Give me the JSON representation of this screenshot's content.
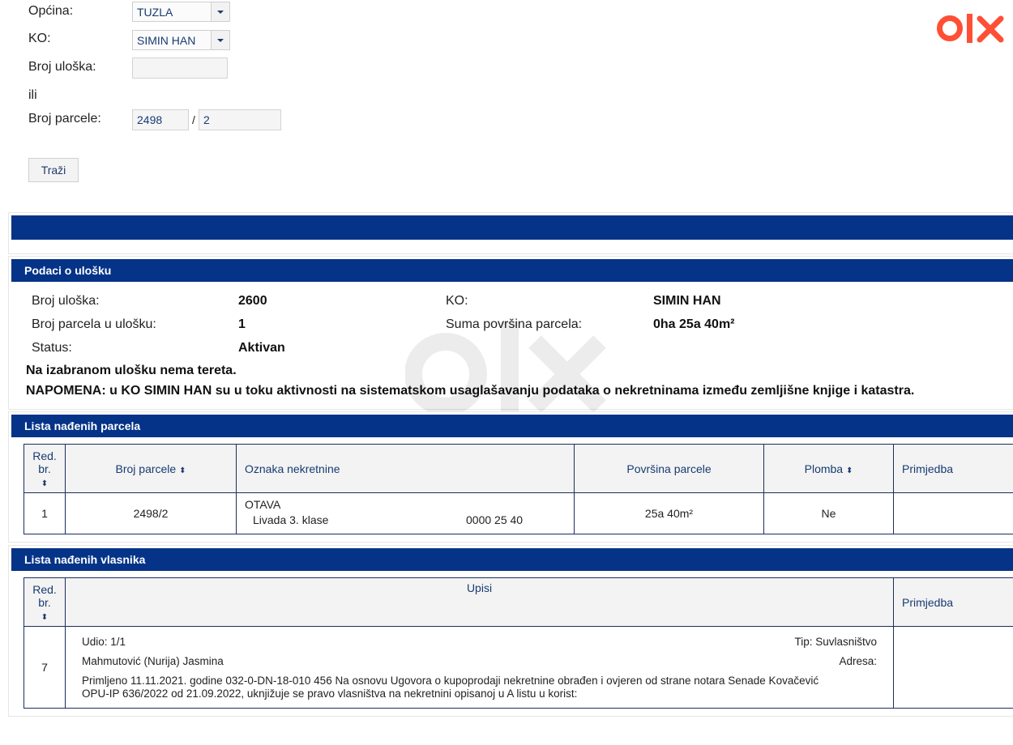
{
  "form": {
    "opcina_label": "Općina:",
    "opcina_value": "TUZLA",
    "ko_label": "KO:",
    "ko_value": "SIMIN HAN",
    "broj_uloska_label": "Broj uloška:",
    "broj_uloska_value": "",
    "ili": "ili",
    "broj_parcele_label": "Broj parcele:",
    "parcela_broj": "2498",
    "parcela_separator": "/",
    "parcela_podbroj": "2",
    "search_button": "Traži"
  },
  "logo": {
    "icon": "olx-logo",
    "color": "#ff4f35"
  },
  "podaci": {
    "title": "Podaci o ulošku",
    "broj_uloska_label": "Broj uloška:",
    "broj_uloska_value": "2600",
    "broj_parcela_label": "Broj parcela u ulošku:",
    "broj_parcela_value": "1",
    "status_label": "Status:",
    "status_value": "Aktivan",
    "ko_label": "KO:",
    "ko_value": "SIMIN HAN",
    "suma_label": "Suma površina parcela:",
    "suma_value": "0ha 25a 40m²",
    "no_encumbrance": "Na izabranom ulošku nema tereta.",
    "napomena": "NAPOMENA: u KO SIMIN HAN su u toku aktivnosti na sistematskom usaglašavanju podataka o nekretninama između zemljišne knjige i katastra."
  },
  "parcele": {
    "title": "Lista nađenih parcela",
    "headers": {
      "red_br": "Red. br.",
      "broj_parcele": "Broj parcele",
      "oznaka": "Oznaka nekretnine",
      "povrsina": "Površina parcele",
      "plomba": "Plomba",
      "primjedba": "Primjedba"
    },
    "rows": [
      {
        "red_br": "1",
        "broj_parcele": "2498/2",
        "oznaka_naziv": "OTAVA",
        "oznaka_kultura": "Livada 3. klase",
        "oznaka_povrsina": "0000 25 40",
        "povrsina": "25a 40m²",
        "plomba": "Ne",
        "primjedba": ""
      }
    ]
  },
  "vlasnici": {
    "title": "Lista nađenih vlasnika",
    "headers": {
      "red_br": "Red. br.",
      "upisi": "Upisi",
      "primjedba": "Primjedba"
    },
    "rows": [
      {
        "red_br": "7",
        "udio": "Udio: 1/1",
        "tip": "Tip: Suvlasništvo",
        "ime": "Mahmutović (Nurija) Jasmina",
        "adresa": "Adresa:",
        "opis_line1": "Primljeno 11.11.2021. godine 032-0-DN-18-010 456 Na osnovu Ugovora o kupoprodaji nekretnine obrađen i ovjeren od strane notara Senade Kovačević",
        "opis_line2": "OPU-IP 636/2022 od 21.09.2022, uknjižuje se pravo vlasništva na nekretnini opisanoj u A listu u korist:",
        "primjedba": ""
      }
    ]
  },
  "colors": {
    "header_bar": "#043387",
    "link_text": "#173b72"
  }
}
